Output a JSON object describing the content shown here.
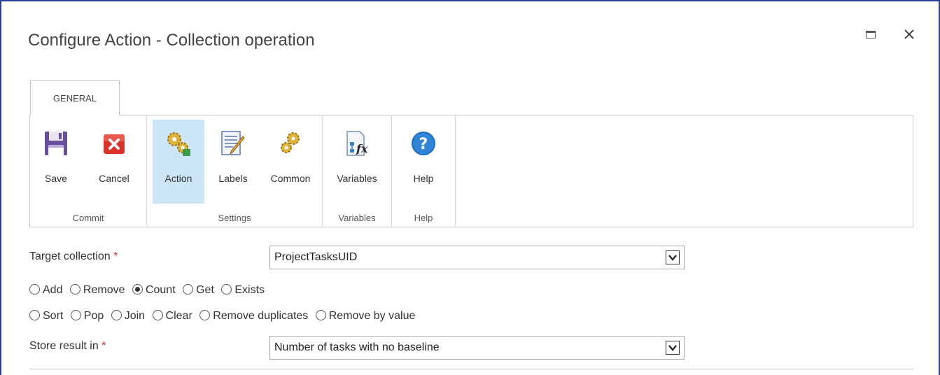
{
  "dialog": {
    "title": "Configure Action - Collection operation",
    "close_glyph": "✕"
  },
  "tab": {
    "label": "GENERAL"
  },
  "ribbon": {
    "groups": [
      {
        "label": "Commit",
        "buttons": [
          {
            "label": "Save",
            "icon": "save-icon"
          },
          {
            "label": "Cancel",
            "icon": "cancel-icon"
          }
        ]
      },
      {
        "label": "Settings",
        "buttons": [
          {
            "label": "Action",
            "icon": "action-gears-icon",
            "selected": true
          },
          {
            "label": "Labels",
            "icon": "labels-icon"
          },
          {
            "label": "Common",
            "icon": "common-gears-icon"
          }
        ]
      },
      {
        "label": "Variables",
        "buttons": [
          {
            "label": "Variables",
            "icon": "variables-fx-icon"
          }
        ]
      },
      {
        "label": "Help",
        "buttons": [
          {
            "label": "Help",
            "icon": "help-icon"
          }
        ]
      }
    ]
  },
  "form": {
    "target_collection": {
      "label": "Target collection",
      "required_mark": "*",
      "value": "ProjectTasksUID"
    },
    "operations_row1": [
      "Add",
      "Remove",
      "Count",
      "Get",
      "Exists"
    ],
    "operations_row2": [
      "Sort",
      "Pop",
      "Join",
      "Clear",
      "Remove duplicates",
      "Remove by value"
    ],
    "selected_operation": "Count",
    "store_result": {
      "label": "Store result in",
      "required_mark": "*",
      "value": "Number of tasks with no baseline"
    }
  },
  "colors": {
    "accent_border": "#2a3f9e",
    "selected_button_bg": "#cde6f7",
    "required": "#c0392b"
  }
}
